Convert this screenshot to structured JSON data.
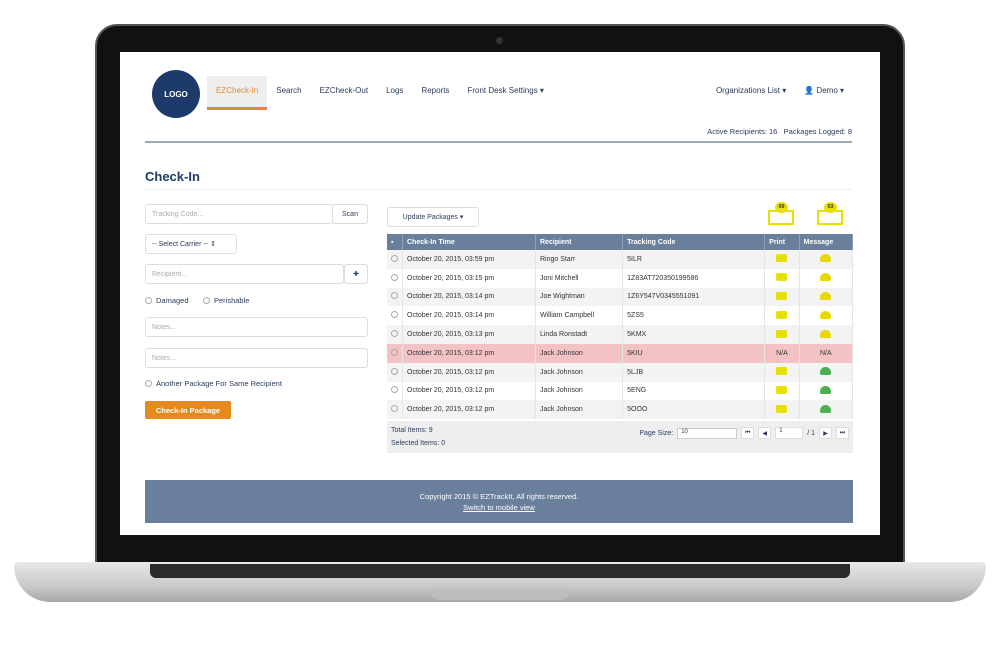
{
  "logo": "LOGO",
  "nav": [
    "EZCheck-In",
    "Search",
    "EZCheck-Out",
    "Logs",
    "Reports",
    "Front Desk Settings ▾"
  ],
  "right_nav": {
    "orgs": "Organizations List ▾",
    "user": "Demo ▾"
  },
  "stats": {
    "active": "Active Recipients: 16",
    "logged": "Packages Logged: 8"
  },
  "title": "Check-In",
  "form": {
    "tracking_placeholder": "Tracking Code...",
    "scan": "Scan",
    "carrier": "-- Select Carrier --  ⇕",
    "recipient_placeholder": "Recipient...",
    "add": "✚",
    "damaged": "Damaged",
    "perishable": "Perishable",
    "notes_placeholder": "Notes...",
    "another": "Another Package For Same Recipient",
    "submit": "Check-In Package"
  },
  "update": "Update Packages ▾",
  "badges": {
    "print": "09",
    "message": "03"
  },
  "table": {
    "headers": [
      "Check-In Time",
      "Recipient",
      "Tracking Code",
      "Print",
      "Message"
    ],
    "rows": [
      [
        "October 20, 2015, 03:59 pm",
        "Ringo Starr",
        "5ILR",
        "print",
        "yellow"
      ],
      [
        "October 20, 2015, 03:15 pm",
        "Joni Mitchell",
        "1Z83AT720350199586",
        "print",
        "yellow"
      ],
      [
        "October 20, 2015, 03:14 pm",
        "Joe Wightman",
        "1Z6Y547V0345551091",
        "print",
        "yellow"
      ],
      [
        "October 20, 2015, 03:14 pm",
        "William Campbell",
        "5ZS5",
        "print",
        "yellow"
      ],
      [
        "October 20, 2015, 03:13 pm",
        "Linda Ronstadt",
        "5KMX",
        "print",
        "yellow"
      ],
      [
        "October 20, 2015, 03:12 pm",
        "Jack Johnson",
        "5KIU",
        "N/A",
        "N/A"
      ],
      [
        "October 20, 2015, 03:12 pm",
        "Jack Johnson",
        "5LJB",
        "print",
        "green"
      ],
      [
        "October 20, 2015, 03:12 pm",
        "Jack Johnson",
        "5ENG",
        "print",
        "green"
      ],
      [
        "October 20, 2015, 03:12 pm",
        "Jack Johnson",
        "5OOO",
        "print",
        "green"
      ]
    ]
  },
  "pager": {
    "total": "Total Items: 9",
    "selected": "Selected Items: 0",
    "page_size_label": "Page Size:",
    "page_size": "10",
    "page": "1",
    "of": "/ 1"
  },
  "footer": {
    "copyright": "Copyright 2015 © EZTrackIt, All rights reserved.",
    "mobile": "Switch to mobile view"
  },
  "colors": {
    "accent": "#e58a1f",
    "navy": "#1d3a6b",
    "header": "#6a7f9c",
    "error_row": "#f3c2c4"
  }
}
